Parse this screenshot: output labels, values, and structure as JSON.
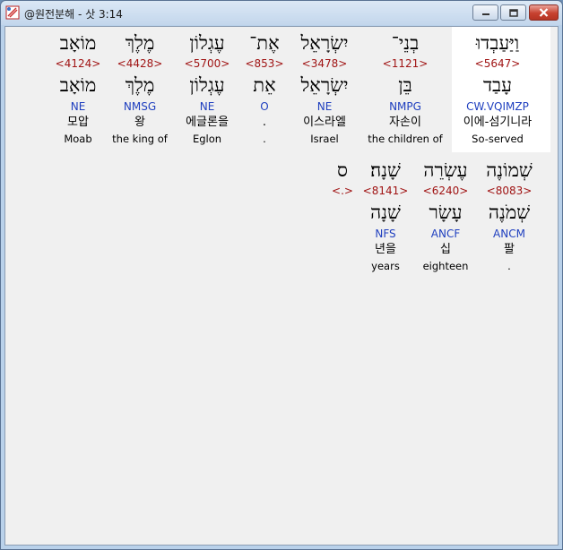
{
  "window": {
    "title": "@원전분해 - 삿 3:14"
  },
  "rows": [
    {
      "words": [
        {
          "hebrew": "וַיַּעַבְדוּ",
          "strong": "<5647>",
          "lemma": "עָבַד",
          "parse": "CW.VQIMZP",
          "korean": "이에-섬기니라",
          "english": "So-served",
          "selected": true
        },
        {
          "hebrew": "בְנֵי־",
          "strong": "<1121>",
          "lemma": "בֵּן",
          "parse": "NMPG",
          "korean": "자손이",
          "english": "the children of"
        },
        {
          "hebrew": "יִשְׂרָאֵל",
          "strong": "<3478>",
          "lemma": "יִשְׂרָאֵל",
          "parse": "NE",
          "korean": "이스라엘",
          "english": "Israel"
        },
        {
          "hebrew": "אֶת־",
          "strong": "<853>",
          "lemma": "אֵת",
          "parse": "O",
          "korean": ".",
          "english": "."
        },
        {
          "hebrew": "עֶגְלוֹן",
          "strong": "<5700>",
          "lemma": "עֶגְלוֹן",
          "parse": "NE",
          "korean": "에글론을",
          "english": "Eglon"
        },
        {
          "hebrew": "מֶלֶךְ",
          "strong": "<4428>",
          "lemma": "מֶלֶךְ",
          "parse": "NMSG",
          "korean": "왕",
          "english": "the king of"
        },
        {
          "hebrew": "מוֹאָב",
          "strong": "<4124>",
          "lemma": "מוֹאָב",
          "parse": "NE",
          "korean": "모압",
          "english": "Moab"
        }
      ]
    },
    {
      "words": [
        {
          "hebrew": "שְׁמוֹנֶה",
          "strong": "<8083>",
          "lemma": "שְׁמֹנֶה",
          "parse": "ANCM",
          "korean": "팔",
          "english": "."
        },
        {
          "hebrew": "עֶשְׂרֵה",
          "strong": "<6240>",
          "lemma": "עָשָׂר",
          "parse": "ANCF",
          "korean": "십",
          "english": "eighteen"
        },
        {
          "hebrew": "שָׁנָה׃",
          "strong": "<8141>",
          "lemma": "שָׁנָה",
          "parse": "NFS",
          "korean": "년을",
          "english": "years"
        },
        {
          "hebrew": "ס",
          "strong": "<.>",
          "lemma": "",
          "parse": "",
          "korean": "",
          "english": ""
        }
      ]
    }
  ],
  "colors": {
    "strong": "#a01414",
    "parse": "#1f3fbf",
    "selected_bg": "#ffffff"
  }
}
